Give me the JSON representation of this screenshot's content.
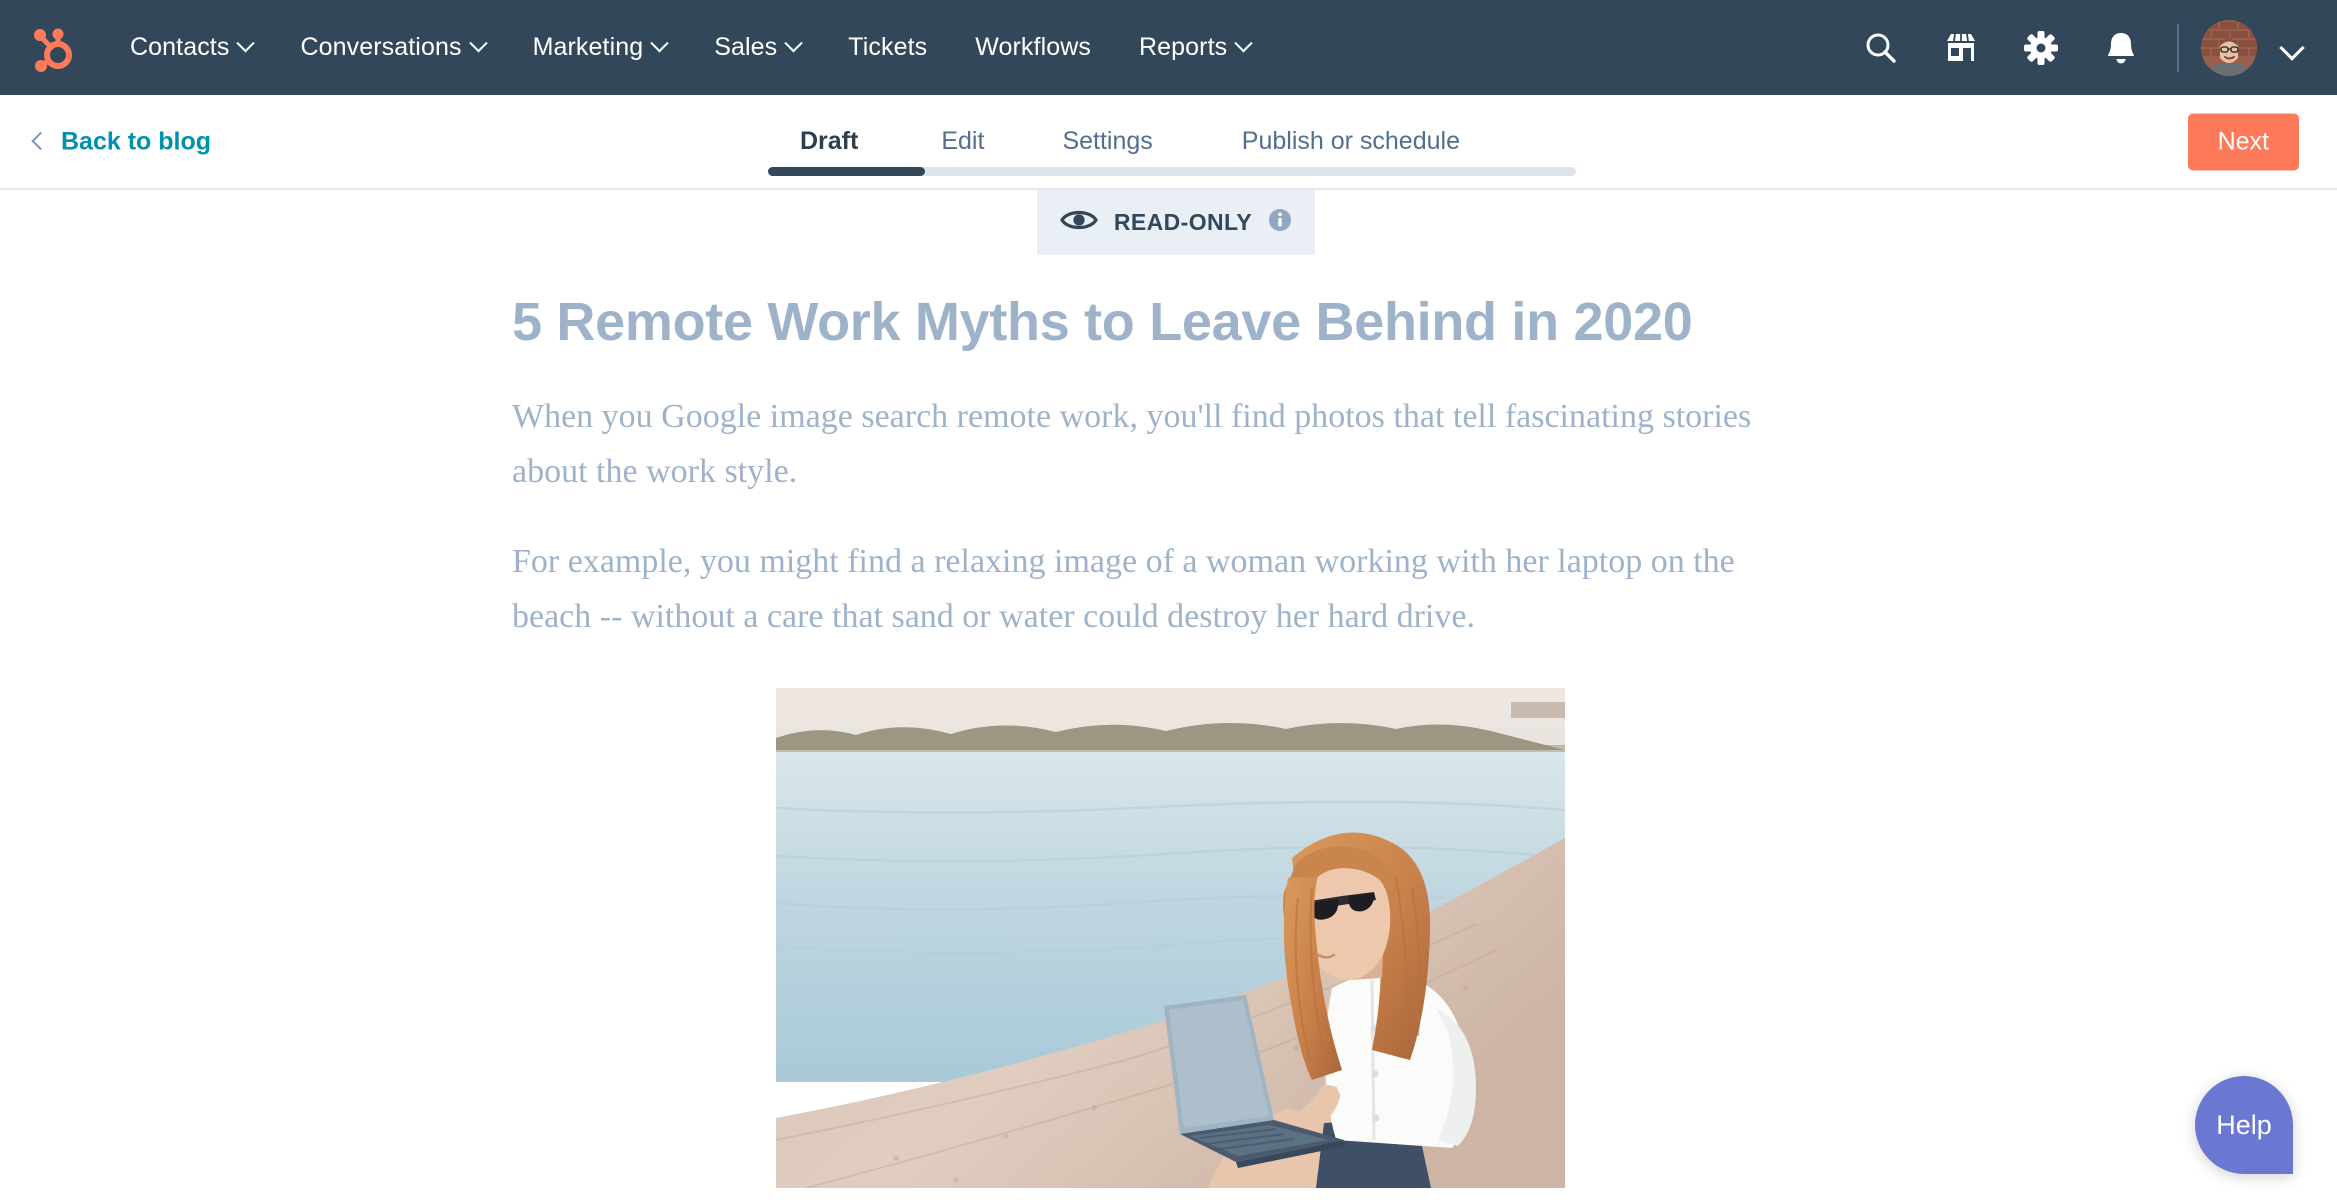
{
  "topnav": {
    "logo_icon": "hubspot-sprocket-icon",
    "items": [
      {
        "label": "Contacts",
        "has_caret": true
      },
      {
        "label": "Conversations",
        "has_caret": true
      },
      {
        "label": "Marketing",
        "has_caret": true
      },
      {
        "label": "Sales",
        "has_caret": true
      },
      {
        "label": "Tickets",
        "has_caret": false
      },
      {
        "label": "Workflows",
        "has_caret": false
      },
      {
        "label": "Reports",
        "has_caret": true
      }
    ],
    "icons": [
      "search-icon",
      "marketplace-icon",
      "gear-icon",
      "bell-icon"
    ],
    "avatar": "user-avatar",
    "background_color": "#33475b",
    "accent_color": "#ff7a59"
  },
  "subnav": {
    "back_label": "Back to blog",
    "back_color": "#0091ae",
    "tabs": [
      {
        "label": "Draft",
        "active": true
      },
      {
        "label": "Edit",
        "active": false
      },
      {
        "label": "Settings",
        "active": false
      },
      {
        "label": "Publish or schedule",
        "active": false
      }
    ],
    "next_label": "Next",
    "next_color": "#ff7a59",
    "progress_percent": 19
  },
  "status_badge": {
    "icon": "eye-icon",
    "label": "READ-ONLY",
    "info_icon": "info-icon",
    "background_color": "#eaeff6",
    "text_color": "#33475b"
  },
  "article": {
    "title": "5 Remote Work Myths to Leave Behind in 2020",
    "paragraphs": [
      "When you Google image search remote work, you'll find photos that tell fascinating stories about the work style.",
      "For example, you might find a relaxing image of a woman working with her laptop on the beach -- without a care that sand or water could destroy her hard drive."
    ],
    "text_color": "#9eb3ca",
    "image_alt": "Woman with long blonde hair and sunglasses sitting on a sandy beach by the water, working on a laptop"
  },
  "help": {
    "label": "Help",
    "color": "#6a78d1"
  }
}
